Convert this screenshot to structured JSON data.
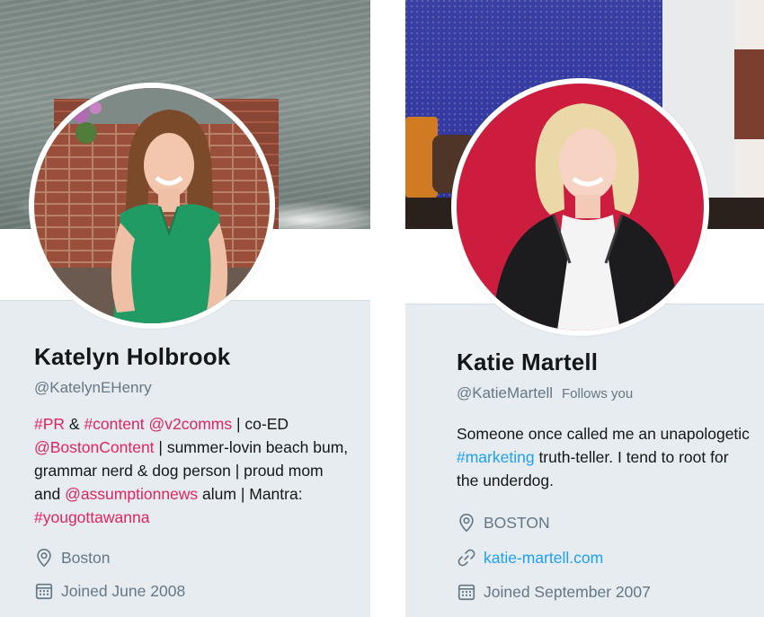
{
  "profiles": [
    {
      "name": "Katelyn Holbrook",
      "handle": "@KatelynEHenry",
      "bio": [
        {
          "text": "#PR",
          "type": "tag"
        },
        {
          "text": " & ",
          "type": "text"
        },
        {
          "text": "#content",
          "type": "tag"
        },
        {
          "text": " ",
          "type": "text"
        },
        {
          "text": "@v2comms",
          "type": "tag"
        },
        {
          "text": " | co-ED ",
          "type": "text"
        },
        {
          "text": "@BostonContent",
          "type": "tag"
        },
        {
          "text": " | summer-lovin beach bum, grammar nerd & dog person | proud mom and ",
          "type": "text"
        },
        {
          "text": "@assumptionnews",
          "type": "tag"
        },
        {
          "text": " alum | Mantra: ",
          "type": "text"
        },
        {
          "text": "#yougottawanna",
          "type": "tag"
        }
      ],
      "location": "Boston",
      "joined": "Joined June 2008",
      "location_icon": "location-pin-icon",
      "joined_icon": "calendar-icon"
    },
    {
      "name": "Katie Martell",
      "handle": "@KatieMartell",
      "follows_you": "Follows you",
      "bio": [
        {
          "text": "Someone once called me an unapologetic ",
          "type": "text"
        },
        {
          "text": "#marketing",
          "type": "tag-blue"
        },
        {
          "text": " truth-teller. I tend to root for the underdog.",
          "type": "text"
        }
      ],
      "location": "BOSTON",
      "website": "katie-martell.com",
      "joined": "Joined September 2007",
      "location_icon": "location-pin-icon",
      "link_icon": "link-icon",
      "joined_icon": "calendar-icon"
    }
  ],
  "colors": {
    "hashtag_left": "#e0245e",
    "link_blue": "#1da1f2",
    "secondary_text": "#657786",
    "panel_bg": "#e6ecf0"
  }
}
